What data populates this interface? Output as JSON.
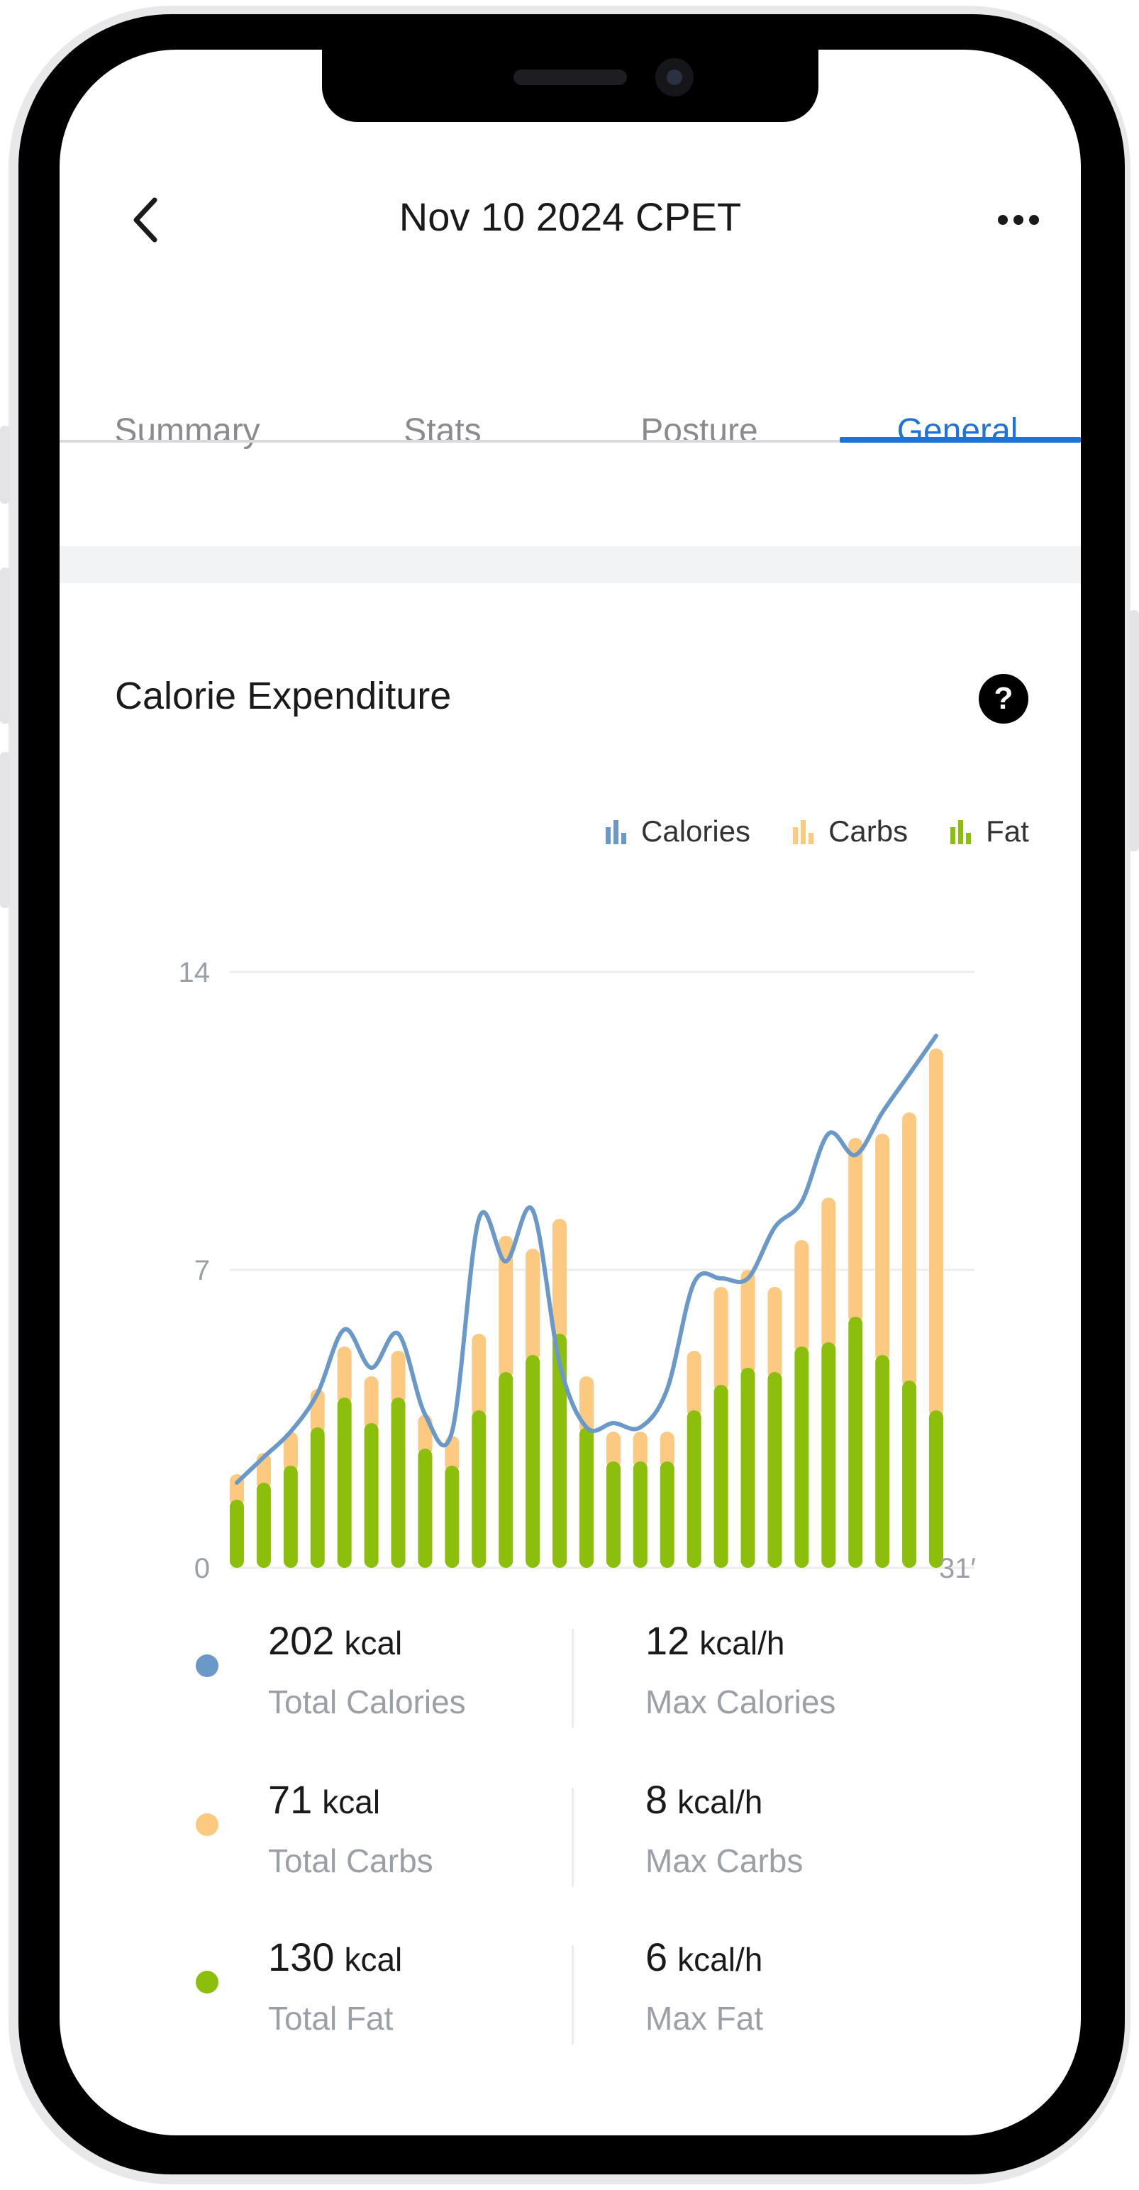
{
  "header": {
    "title": "Nov 10 2024 CPET"
  },
  "tabs": [
    {
      "label": "Summary",
      "active": false
    },
    {
      "label": "Stats",
      "active": false
    },
    {
      "label": "Posture",
      "active": false
    },
    {
      "label": "General",
      "active": true
    }
  ],
  "card": {
    "title": "Calorie Expenditure",
    "help_icon": "?"
  },
  "legend": [
    {
      "label": "Calories",
      "color": "#6a98c8"
    },
    {
      "label": "Carbs",
      "color": "#fcc980"
    },
    {
      "label": "Fat",
      "color": "#8cbf0b"
    }
  ],
  "colors": {
    "accent": "#1e73d6",
    "calories": "#6a98c8",
    "carbs": "#fcc980",
    "fat": "#8cbf0b"
  },
  "chart_data": {
    "type": "bar",
    "stacked": true,
    "y_ticks": [
      "14",
      "7",
      "0"
    ],
    "ylim": [
      0,
      14
    ],
    "x_end_label": "31′",
    "grid": true,
    "legend_position": "top-right",
    "series": [
      {
        "name": "Fat",
        "values": [
          1.6,
          2.0,
          2.4,
          3.3,
          4.0,
          3.4,
          4.0,
          2.8,
          2.4,
          3.7,
          4.6,
          5.0,
          5.5,
          3.3,
          2.5,
          2.5,
          2.5,
          3.7,
          4.3,
          4.7,
          4.6,
          5.2,
          5.3,
          5.9,
          5.0,
          4.4,
          3.7
        ]
      },
      {
        "name": "Carbs",
        "values": [
          0.6,
          0.7,
          0.8,
          0.9,
          1.2,
          1.1,
          1.1,
          0.8,
          0.7,
          1.8,
          3.2,
          2.5,
          2.7,
          1.2,
          0.7,
          0.7,
          0.7,
          1.4,
          2.3,
          2.3,
          2.0,
          2.5,
          3.4,
          4.2,
          5.2,
          6.3,
          8.5
        ]
      },
      {
        "name": "Calories",
        "values": [
          2.0,
          2.6,
          3.2,
          4.1,
          5.6,
          4.7,
          5.5,
          3.6,
          3.2,
          8.2,
          7.2,
          8.4,
          4.8,
          3.3,
          3.4,
          3.3,
          4.2,
          6.7,
          6.8,
          6.8,
          8.0,
          8.6,
          10.2,
          9.7,
          10.7,
          11.6,
          12.5
        ]
      }
    ]
  },
  "stats": [
    {
      "value": "202",
      "unit": "kcal",
      "label": "Total Calories",
      "color": "#6a98c8"
    },
    {
      "value": "12",
      "unit": "kcal/h",
      "label": "Max Calories"
    },
    {
      "value": "71",
      "unit": "kcal",
      "label": "Total Carbs",
      "color": "#fcc980"
    },
    {
      "value": "8",
      "unit": "kcal/h",
      "label": "Max Carbs"
    },
    {
      "value": "130",
      "unit": "kcal",
      "label": "Total Fat",
      "color": "#8cbf0b"
    },
    {
      "value": "6",
      "unit": "kcal/h",
      "label": "Max Fat"
    }
  ],
  "icons": {
    "back": "chevron-left-icon",
    "more": "more-dots-icon",
    "help": "help-icon",
    "legend": "bar-chart-icon"
  }
}
